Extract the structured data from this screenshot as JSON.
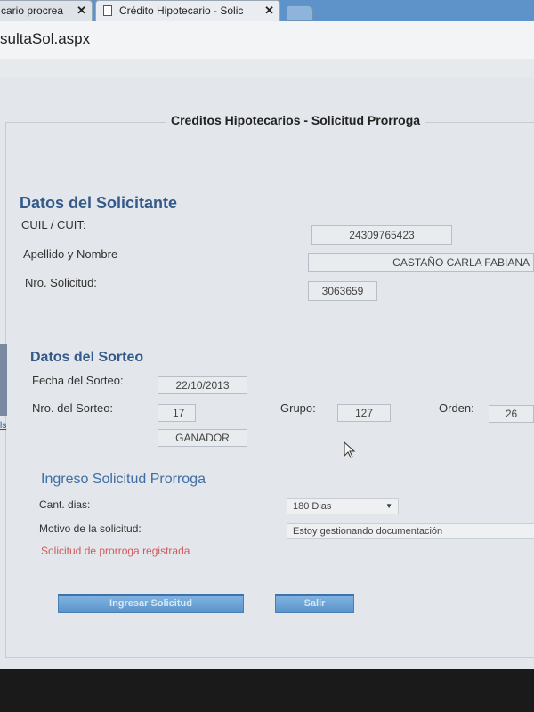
{
  "browser": {
    "tabs": [
      {
        "label": "cario procrea"
      },
      {
        "label": "Crédito Hipotecario - Solic"
      }
    ],
    "address": "sultaSol.aspx"
  },
  "page": {
    "title": "Creditos Hipotecarios - Solicitud Prorroga",
    "solicitante": {
      "heading": "Datos del Solicitante",
      "cuil_label": "CUIL / CUIT:",
      "cuil_value": "24309765423",
      "nombre_label": "Apellido y Nombre",
      "nombre_value": "CASTAÑO CARLA FABIANA",
      "solicitud_label": "Nro. Solicitud:",
      "solicitud_value": "3063659"
    },
    "sorteo": {
      "heading": "Datos del Sorteo",
      "fecha_label": "Fecha del Sorteo:",
      "fecha_value": "22/10/2013",
      "nro_label": "Nro. del Sorteo:",
      "nro_value": "17",
      "grupo_label": "Grupo:",
      "grupo_value": "127",
      "orden_label": "Orden:",
      "orden_value": "26",
      "resultado_value": "GANADOR"
    },
    "prorroga": {
      "heading": "Ingreso Solicitud Prorroga",
      "dias_label": "Cant. dias:",
      "dias_value": "180 Dias",
      "motivo_label": "Motivo de la solicitud:",
      "motivo_value": "Estoy gestionando documentación",
      "status_message": "Solicitud de prorroga registrada"
    },
    "buttons": {
      "ingresar": "Ingresar Solicitud",
      "salir": "Salir"
    },
    "left_link": "ls"
  }
}
